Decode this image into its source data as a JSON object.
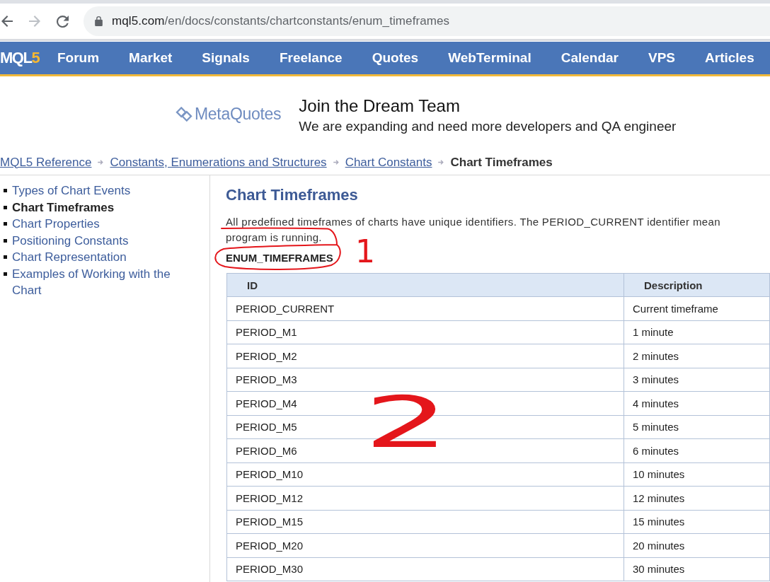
{
  "browser": {
    "buttons": [
      {
        "kind": "back",
        "disabled": false
      },
      {
        "kind": "forward",
        "disabled": true
      },
      {
        "kind": "reload",
        "disabled": false
      }
    ],
    "url": {
      "host": "mql5.com",
      "path": "/en/docs/constants/chartconstants/enum_timeframes"
    }
  },
  "nav": {
    "logo": {
      "text": "MQL",
      "accent": "5"
    },
    "items": [
      "Forum",
      "Market",
      "Signals",
      "Freelance",
      "Quotes",
      "WebTerminal",
      "Calendar",
      "VPS",
      "Articles"
    ]
  },
  "banner": {
    "logo": "MetaQuotes",
    "title": "Join the Dream Team",
    "subtitle": "We are expanding and need more developers and QA engineer"
  },
  "breadcrumb": {
    "links": [
      "MQL5 Reference",
      "Constants, Enumerations and Structures",
      "Chart Constants"
    ],
    "current": "Chart Timeframes"
  },
  "sidebar": {
    "items": [
      {
        "label": "Types of Chart Events",
        "selected": false
      },
      {
        "label": "Chart Timeframes",
        "selected": true
      },
      {
        "label": "Chart Properties",
        "selected": false
      },
      {
        "label": "Positioning Constants",
        "selected": false
      },
      {
        "label": "Chart Representation",
        "selected": false
      },
      {
        "label": "Examples of Working with the Chart",
        "selected": false
      }
    ]
  },
  "content": {
    "title": "Chart Timeframes",
    "intro_lines": [
      "All predefined timeframes of charts have unique identifiers. The PERIOD_CURRENT identifier mean",
      "program is running."
    ],
    "enum_name": "ENUM_TIMEFRAMES",
    "table": {
      "columns": [
        "ID",
        "Description"
      ],
      "rows": [
        [
          "PERIOD_CURRENT",
          "Current timeframe"
        ],
        [
          "PERIOD_M1",
          "1 minute"
        ],
        [
          "PERIOD_M2",
          "2 minutes"
        ],
        [
          "PERIOD_M3",
          "3 minutes"
        ],
        [
          "PERIOD_M4",
          "4 minutes"
        ],
        [
          "PERIOD_M5",
          "5 minutes"
        ],
        [
          "PERIOD_M6",
          "6 minutes"
        ],
        [
          "PERIOD_M10",
          "10 minutes"
        ],
        [
          "PERIOD_M12",
          "12 minutes"
        ],
        [
          "PERIOD_M15",
          "15 minutes"
        ],
        [
          "PERIOD_M20",
          "20 minutes"
        ],
        [
          "PERIOD_M30",
          "30 minutes"
        ]
      ]
    }
  },
  "annotations": [
    {
      "kind": "ellipse"
    },
    {
      "kind": "digit",
      "text": "1"
    },
    {
      "kind": "digit",
      "text": "2"
    }
  ]
}
